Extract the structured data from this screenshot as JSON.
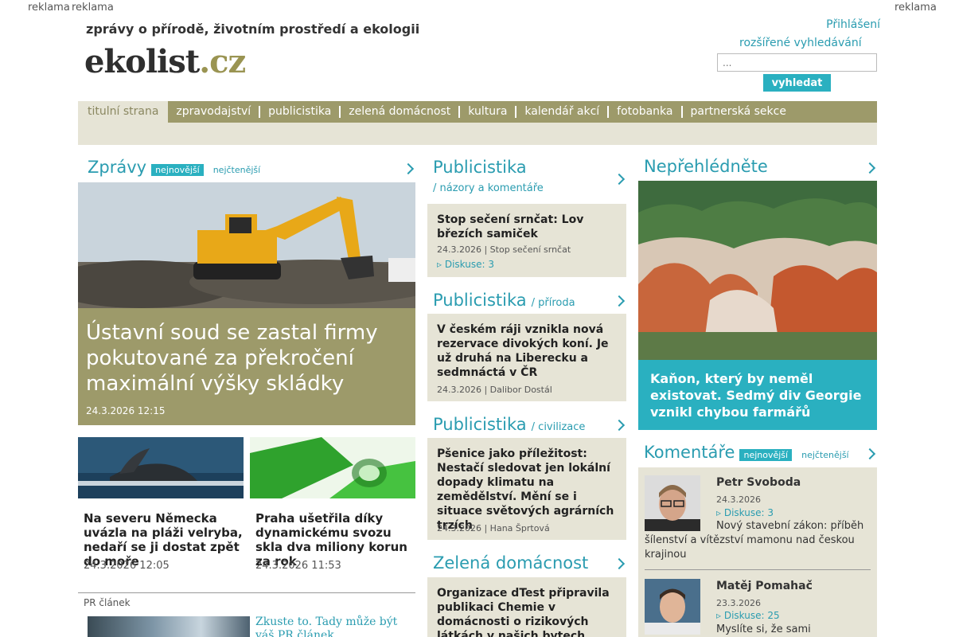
{
  "ads": {
    "left1": "reklama",
    "left2": "reklama",
    "right": "reklama"
  },
  "header": {
    "tagline": "zprávy o přírodě, životním prostředí a ekologii",
    "logo_main": "ekolist",
    "logo_tld": ".cz",
    "login": "Přihlášení",
    "advanced_search": "rozšířené vyhledávání",
    "search_placeholder": "...",
    "search_button": "vyhledat"
  },
  "nav": [
    "titulní strana",
    "zpravodajství",
    "publicistika",
    "zelená domácnost",
    "kultura",
    "kalendář akcí",
    "fotobanka",
    "partnerská sekce"
  ],
  "news": {
    "title": "Zprávy",
    "tab_newest": "nejnovější",
    "tab_most_read": "nejčtenější",
    "main": {
      "headline": "Ústavní soud se zastal firmy pokutované za překročení maximální výšky skládky",
      "date": "24.3.2026 12:15"
    },
    "small": [
      {
        "headline": "Na severu Německa uvázla na pláži velryba, nedaří se ji dostat zpět do moře",
        "date": "24.3.2026 12:05"
      },
      {
        "headline": "Praha ušetřila díky dynamickému svozu skla dva miliony korun za rok",
        "date": "24.3.2026 11:53"
      }
    ],
    "pr_label": "PR článek",
    "pr_text": "Zkuste to. Tady může být váš PR článek"
  },
  "publicistika": [
    {
      "title": "Publicistika",
      "sub": "/ názory a komentáře",
      "headline": "Stop sečení srnčat: Lov březích samiček",
      "meta": "24.3.2026 | Stop sečení srnčat",
      "discussion": "Diskuse: 3"
    },
    {
      "title": "Publicistika",
      "sub": "/ příroda",
      "headline": "V českém ráji vznikla nová rezervace divokých koní. Je už druhá na Liberecku a sedmnáctá v ČR",
      "meta": "24.3.2026 | Dalibor Dostál"
    },
    {
      "title": "Publicistika",
      "sub": "/ civilizace",
      "headline": "Pšenice jako příležitost: Nestačí sledovat jen lokální dopady klimatu na zemědělství. Mění se i situace světových agrárních trzích",
      "meta": "24.3.2026 | Hana Šprtová"
    },
    {
      "title": "Zelená domácnost",
      "sub": "",
      "headline": "Organizace dTest připravila publikaci Chemie v domácnosti o rizikových látkách v našich bytech"
    }
  ],
  "featured": {
    "title": "Nepřehlédněte",
    "headline": "Kaňon, který by neměl existovat. Sedmý div Georgie vznikl chybou farmářů"
  },
  "comments": {
    "title": "Komentáře",
    "tab_newest": "nejnovější",
    "tab_most_read": "nejčtenější",
    "items": [
      {
        "name": "Petr Svoboda",
        "date": "24.3.2026",
        "discussion": "Diskuse: 3",
        "text": "Nový stavební zákon: příběh šílenství a vítězství mamonu nad českou krajinou"
      },
      {
        "name": "Matěj Pomahač",
        "date": "23.3.2026",
        "discussion": "Diskuse: 25",
        "text": "Myslíte si, že sami rozhodujete"
      }
    ]
  },
  "colors": {
    "accent": "#2ab0c0",
    "olive": "#9d9a6a",
    "beige": "#e6e4d6"
  }
}
